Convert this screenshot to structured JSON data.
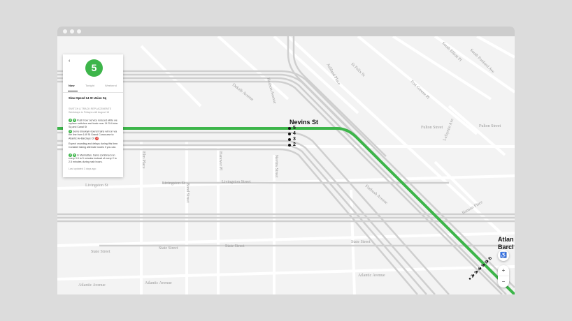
{
  "window": {
    "title_dots": 3
  },
  "map": {
    "station": {
      "name": "Nevins St",
      "routes": [
        "5",
        "4",
        "3",
        "2"
      ]
    },
    "station_atlantic": {
      "name_line1": "Atlan",
      "name_line2": "Barcl",
      "routes": [
        "B",
        "D",
        "5",
        "4",
        "3",
        "2"
      ]
    },
    "street_labels": [
      "Dekalb Avenue",
      "Ashland Place",
      "St Felix St",
      "Fort Greene Pl",
      "South Elliott Pl",
      "South Portland Ave",
      "Fulton Street",
      "Fulton Street",
      "Flatbush Avenue",
      "Hudson Avenue",
      "Nevins Street",
      "Bond Street",
      "Elm Place",
      "Hanover Pl",
      "Livingston St",
      "Livingston St",
      "Livingston Street",
      "State Street",
      "State Street",
      "State Street",
      "State Street",
      "Atlantic Avenue",
      "Atlantic Avenue",
      "Atlantic Avenue",
      "Lafayette Ave",
      "Hanson Place"
    ],
    "controls": {
      "accessible_icon": "wheelchair-icon",
      "zoom_in": "+",
      "zoom_out": "−"
    },
    "colors": {
      "line_green": "#3db54a",
      "track_gray": "#c8c8c8",
      "street": "#ffffff",
      "background": "#f3f3f3"
    }
  },
  "panel": {
    "back_icon": "‹",
    "route_badge": "5",
    "tabs": [
      "Now",
      "Tonight",
      "Weekend"
    ],
    "active_tab": "Now",
    "alert_title": "Slow Speed 14 St Union Sq",
    "category": "SWITCH & TRACK REPLACEMENTS",
    "timing": "Weekdays to Fridays until August 16",
    "p1": "Rush hour service reduced while we replace switches and track near 14 St-Union Sq and Canal St",
    "p2": "Some Brooklyn-bound trains will run via the line from 149 St Grand Concourse to Atlantic Av-Barclays Ctr",
    "p3": "Expect crowding and delays during this time. Consider taking alternate routes if you can.",
    "p4": "In Manhattan, trains combined run every 3.5 to 5 minutes instead of every 2 to 2.5 minutes during rush hours.",
    "footer": "Last updated 3 days ago"
  }
}
